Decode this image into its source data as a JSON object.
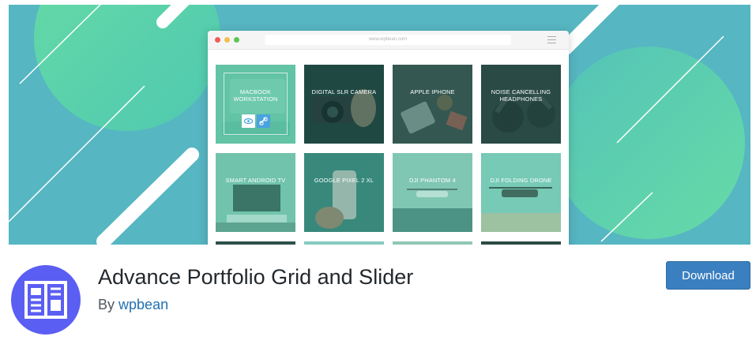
{
  "banner": {
    "url": "www.wpbean.com",
    "tiles": [
      {
        "title": "MACBOOK WORKSTATION"
      },
      {
        "title": "DIGITAL SLR CAMERA"
      },
      {
        "title": "APPLE IPHONE"
      },
      {
        "title": "NOISE CANCELLING HEADPHONES"
      },
      {
        "title": "SMART ANDROID TV"
      },
      {
        "title": "GOOGLE PIXEL 2 XL"
      },
      {
        "title": "DJI PHANTOM 4"
      },
      {
        "title": "DJI FOLDING DRONE"
      },
      {
        "title": ""
      },
      {
        "title": ""
      },
      {
        "title": ""
      },
      {
        "title": ""
      }
    ]
  },
  "plugin": {
    "title": "Advance Portfolio Grid and Slider",
    "by_label": "By",
    "author": "wpbean",
    "download_label": "Download"
  },
  "colors": {
    "banner_bg": "#56b6c2",
    "banner_circle": "#5fd9a0",
    "tile_overlay": "#4dbfa0",
    "icon_bg": "#5b5ef3",
    "download_bg": "#3a7fc0",
    "author_link": "#2271b1"
  },
  "icons": {
    "plugin": "grid-layout-icon",
    "tile_view": "eye-icon",
    "tile_link": "link-icon"
  }
}
